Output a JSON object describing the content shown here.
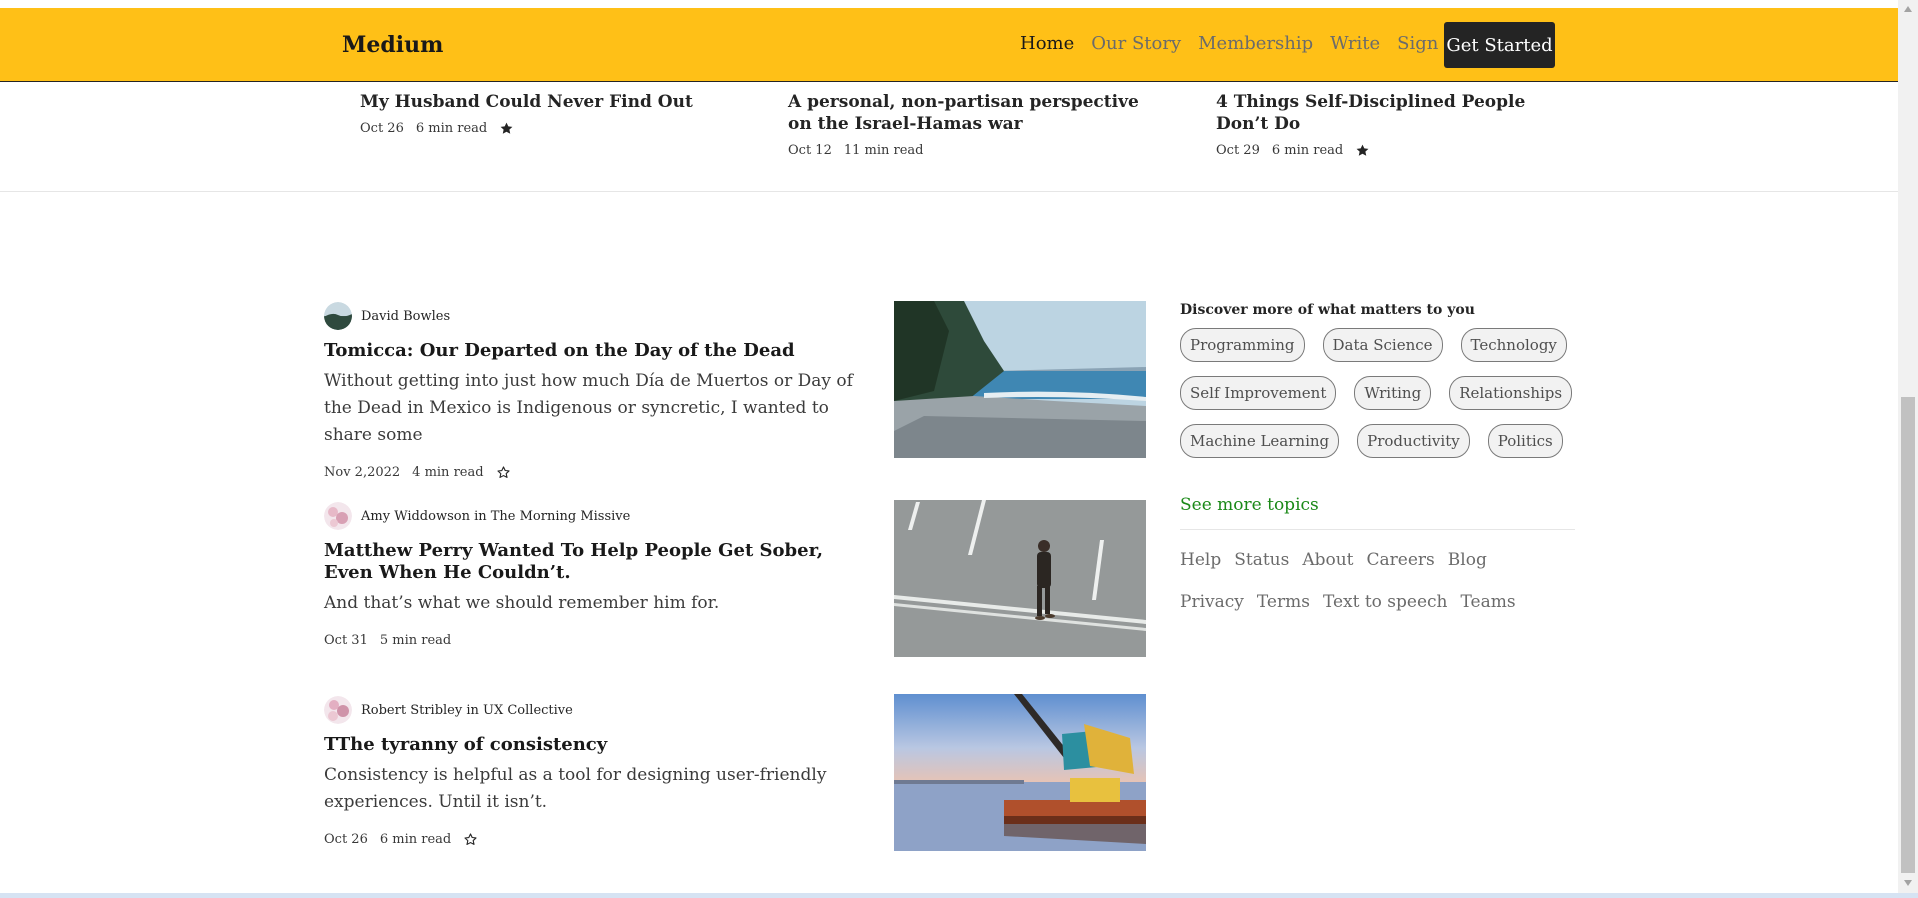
{
  "nav": {
    "brand": "Medium",
    "links": [
      "Home",
      "Our Story",
      "Membership",
      "Write",
      "Sign In"
    ],
    "cta": "Get Started"
  },
  "trending": [
    {
      "title": "My Husband Could Never Find Out",
      "date": "Oct 26",
      "read": "6 min read",
      "starred": true
    },
    {
      "title": "A personal, non-partisan perspective on the Israel-Hamas war",
      "date": "Oct 12",
      "read": "11 min read",
      "starred": false
    },
    {
      "title": "4 Things Self-Disciplined People Don’t Do",
      "date": "Oct 29",
      "read": "6 min read",
      "starred": true
    }
  ],
  "posts": [
    {
      "author": "David Bowles",
      "title": "Tomicca: Our Departed on the Day of the Dead",
      "excerpt": "Without getting into just how much Día de Muertos or Day of the Dead in Mexico is Indigenous or syncretic, I wanted to share some",
      "date": "Nov 2,2022",
      "read": "4 min read",
      "image": "rocky-shoreline-photo"
    },
    {
      "author": "Amy Widdowson in The Morning Missive",
      "title": "Matthew Perry Wanted To Help People Get Sober, Even When He Couldn’t.",
      "excerpt": "And that’s what we should remember him for.",
      "date": "Oct 31",
      "read": "5 min read",
      "image": "man-walking-road-photo"
    },
    {
      "author": "Robert Stribley in UX Collective",
      "title": "TThe tyranny of consistency",
      "excerpt": "Consistency is helpful as a tool for designing user-friendly experiences. Until it isn’t.",
      "date": "Oct 26",
      "read": "6 min read",
      "image": "crane-barge-photo"
    }
  ],
  "sidebar": {
    "heading": "Discover more of what matters to you",
    "topics": [
      "Programming",
      "Data Science",
      "Technology",
      "Self Improvement",
      "Writing",
      "Relationships",
      "Machine Learning",
      "Productivity",
      "Politics"
    ],
    "see_more": "See more topics",
    "footer_links": [
      "Help",
      "Status",
      "About",
      "Careers",
      "Blog",
      "Privacy",
      "Terms",
      "Text to speech",
      "Teams"
    ]
  },
  "colors": {
    "nav_bg": "#ffc017",
    "cta_bg": "#242424",
    "accent_green": "#1a8917"
  }
}
